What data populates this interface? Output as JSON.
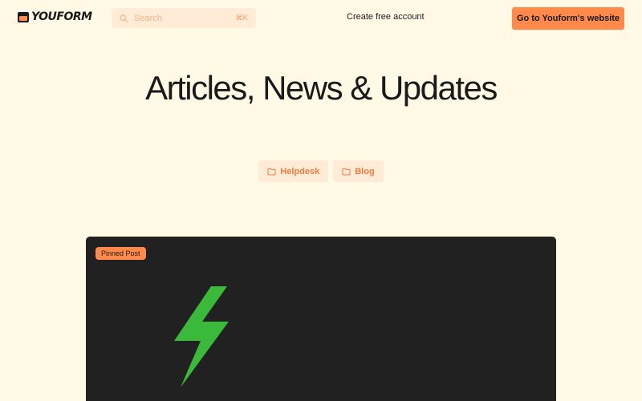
{
  "header": {
    "logo_text": "YOUFORM",
    "search_placeholder": "Search",
    "search_shortcut": "⌘K",
    "create_account": "Create free account",
    "cta_label": "Go to Youform's website"
  },
  "hero": {
    "title": "Articles, News & Updates"
  },
  "categories": [
    {
      "label": "Helpdesk",
      "icon": "folder-icon"
    },
    {
      "label": "Blog",
      "icon": "folder-icon"
    }
  ],
  "pinned_card": {
    "badge": "Pinned Post",
    "image_icon": "lightning-bolt-icon"
  },
  "colors": {
    "background": "#fff9e6",
    "accent": "#ff8a4c",
    "pill_bg": "#ffebd6",
    "pill_text": "#f07b3f",
    "card_bg": "#212121",
    "bolt": "#3bb93b"
  }
}
